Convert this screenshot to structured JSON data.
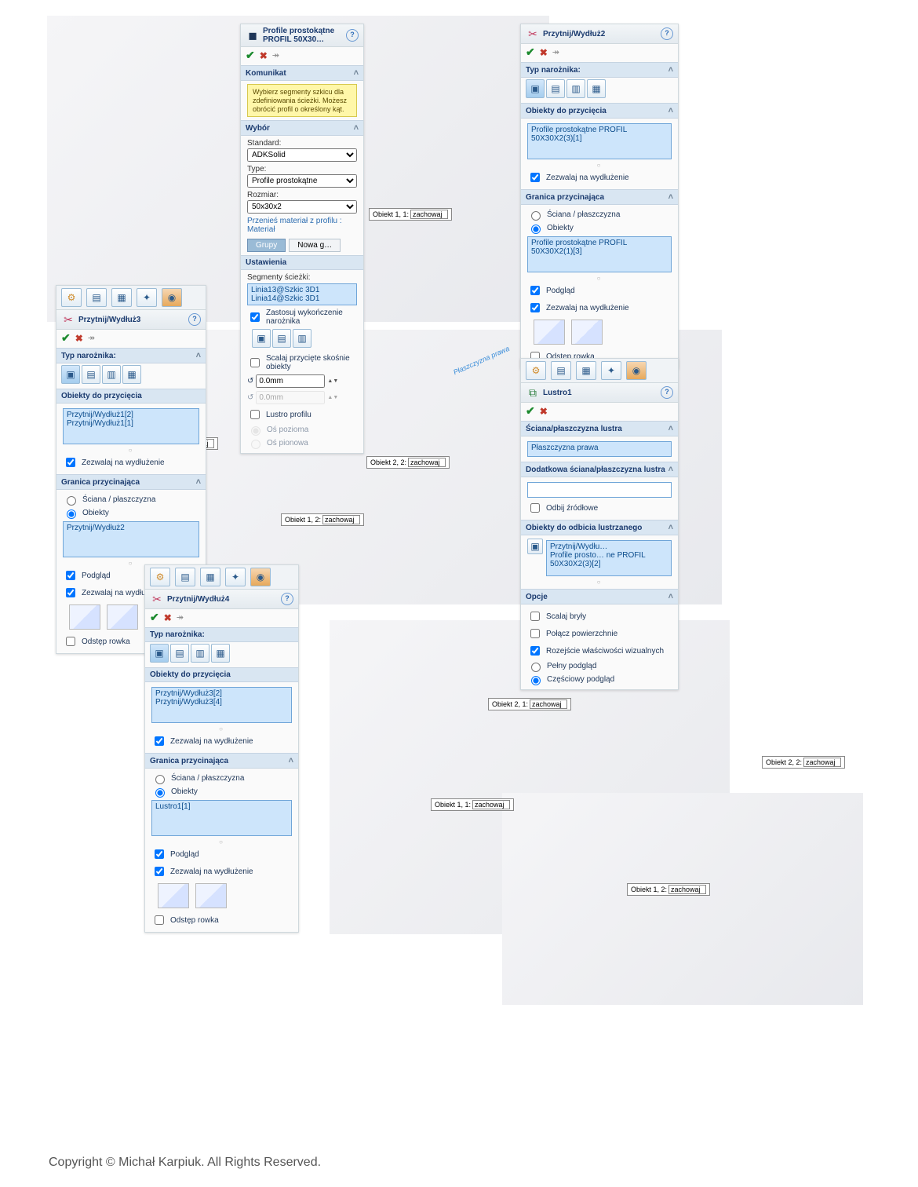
{
  "copyright": "Copyright © Michał Karpiuk. All Rights Reserved.",
  "callouts": {
    "c1": {
      "label": "Obiekt 1, 1:",
      "value": "zachowaj"
    },
    "c2": {
      "label": "Obiekt 2, 1:",
      "value": "zachowaj"
    },
    "c3": {
      "label": "Obiekt 1, 1:",
      "value": "zachowaj"
    },
    "c4": {
      "label": "Obiekt 1, 2:",
      "value": "zachowaj"
    },
    "c5": {
      "label": "Obiekt 2, 2:",
      "value": "zachowaj"
    },
    "c6": {
      "label": "Obiekt 1, 2:",
      "value": "zachowaj"
    },
    "c7": {
      "label": "Obiekt 2, 1:",
      "value": "zachowaj"
    },
    "c8": {
      "label": "Obiekt 1, 1:",
      "value": "zachowaj"
    },
    "c9": {
      "label": "Obiekt 2, 2:",
      "value": "zachowaj"
    },
    "c10": {
      "label": "Obiekt 1, 2:",
      "value": "zachowaj"
    }
  },
  "anno": {
    "right_plane": "Płaszczyzna prawa"
  },
  "panelProfile": {
    "title": "Profile prostokątne PROFIL 50X30…",
    "msg_head": "Komunikat",
    "msg": "Wybierz segmenty szkicu dla zdefiniowania ścieżki. Możesz obrócić profil o określony kąt.",
    "wybor": "Wybór",
    "standard_lbl": "Standard:",
    "standard_val": "ADKSolid",
    "type_lbl": "Type:",
    "type_val": "Profile prostokątne",
    "rozmiar_lbl": "Rozmiar:",
    "rozmiar_val": "50x30x2",
    "material_lbl": "Przenieś materiał z profilu : Materiał",
    "grupy_btn": "Grupy",
    "nowa_btn": "Nowa g…",
    "ustawienia": "Ustawienia",
    "seg_lbl": "Segmenty ścieżki:",
    "seg1": "Linia13@Szkic 3D1",
    "seg2": "Linia14@Szkic 3D1",
    "corner_chk": "Zastosuj wykończenie narożnika",
    "scalaj_chk": "Scalaj przycięte skośnie obiekty",
    "angle1": "0.0mm",
    "angle2": "0.0mm",
    "lustro_chk": "Lustro profilu",
    "os_poz": "Oś pozioma",
    "os_pion": "Oś pionowa"
  },
  "panelTrim2": {
    "title": "Przytnij/Wydłuż2",
    "typ": "Typ narożnika:",
    "obj_head": "Obiekty do przycięcia",
    "obj1": "Profile prostokątne PROFIL 50X30X2(3)[1]",
    "allow": "Zezwalaj na wydłużenie",
    "granica": "Granica przycinająca",
    "opt_face": "Ściana / płaszczyzna",
    "opt_obj": "Obiekty",
    "obj2": "Profile prostokątne PROFIL 50X30X2(1)[3]",
    "podglad": "Podgląd",
    "allow2": "Zezwalaj na wydłużenie",
    "odstep": "Odstęp rowka"
  },
  "panelTrim3": {
    "title": "Przytnij/Wydłuż3",
    "typ": "Typ narożnika:",
    "obj_head": "Obiekty do przycięcia",
    "obj1": "Przytnij/Wydłuż1[2]",
    "obj2": "Przytnij/Wydłuż1[1]",
    "allow": "Zezwalaj na wydłużenie",
    "granica": "Granica przycinająca",
    "opt_face": "Ściana / płaszczyzna",
    "opt_obj": "Obiekty",
    "gsel": "Przytnij/Wydłuż2",
    "podglad": "Podgląd",
    "allow2": "Zezwalaj na wydłużenie",
    "odstep": "Odstęp rowka"
  },
  "panelTrim4": {
    "title": "Przytnij/Wydłuż4",
    "typ": "Typ narożnika:",
    "obj_head": "Obiekty do przycięcia",
    "obj1": "Przytnij/Wydłuż3[2]",
    "obj2": "Przytnij/Wydłuż3[4]",
    "allow": "Zezwalaj na wydłużenie",
    "granica": "Granica przycinająca",
    "opt_face": "Ściana / płaszczyzna",
    "opt_obj": "Obiekty",
    "gsel": "Lustro1[1]",
    "podglad": "Podgląd",
    "allow2": "Zezwalaj na wydłużenie",
    "odstep": "Odstęp rowka"
  },
  "panelMirror": {
    "title": "Lustro1",
    "plane_head": "Ściana/płaszczyzna lustra",
    "plane_sel": "Płaszczyzna prawa",
    "sec_plane_head": "Dodatkowa ściana/płaszczyzna lustra",
    "src_chk": "Odbij źródłowe",
    "obj_head": "Obiekty do odbicia lustrzanego",
    "obj1": "Przytnij/Wydłu…",
    "obj2": "Profile prosto…  ne PROFIL 50X30X2(3)[2]",
    "opcje": "Opcje",
    "scalaj": "Scalaj bryły",
    "polacz": "Połącz powierzchnie",
    "rozej": "Rozejście właściwości wizualnych",
    "pelny": "Pełny podgląd",
    "czesc": "Częściowy podgląd"
  }
}
